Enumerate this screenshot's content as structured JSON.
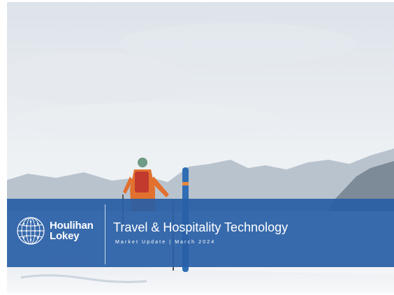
{
  "brand": {
    "logo_line1": "Houlihan",
    "logo_line2": "Lokey",
    "logo_icon": "globe-dot-grid-icon",
    "brand_color": "#2b5fa6"
  },
  "cover": {
    "title": "Travel & Hospitality Technology",
    "subtitle": "Market Update | March 2024"
  }
}
